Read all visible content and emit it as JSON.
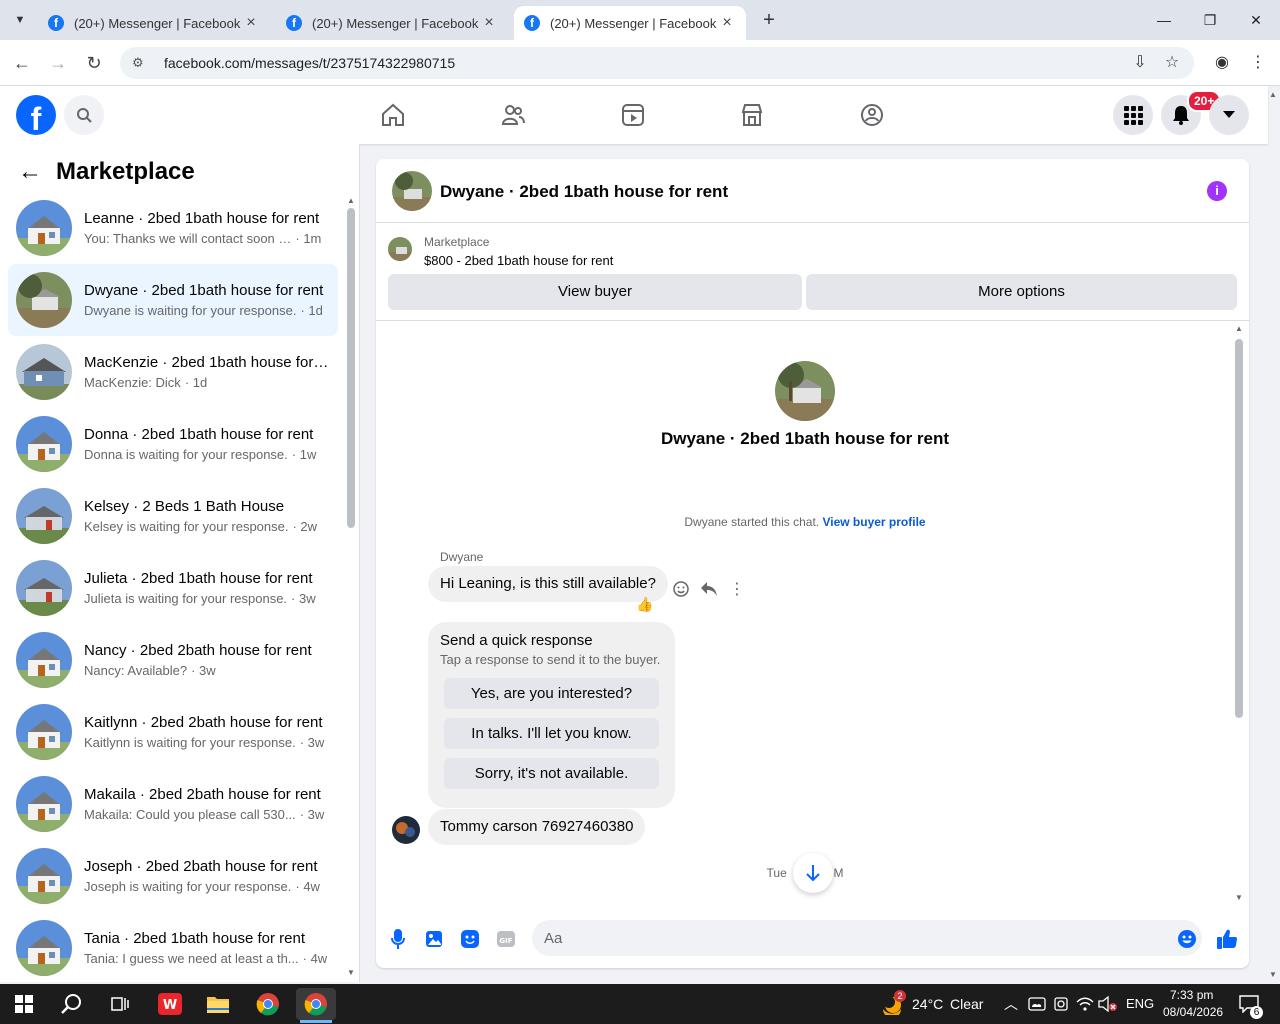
{
  "browser": {
    "tabs": [
      {
        "title": "(20+) Messenger | Facebook",
        "active": false
      },
      {
        "title": "(20+) Messenger | Facebook",
        "active": false
      },
      {
        "title": "(20+) Messenger | Facebook",
        "active": true
      }
    ],
    "url": "facebook.com/messages/t/2375174322980715",
    "new_tab": "+",
    "minimize": "—",
    "restore": "❐",
    "close": "✕"
  },
  "header": {
    "notification_count": "20+"
  },
  "sidebar": {
    "title": "Marketplace",
    "conversations": [
      {
        "title": "Leanne · 2bed 1bath house for rent",
        "snippet": "You: Thanks we will contact soon …",
        "time": "· 1m",
        "active": false,
        "thumb": "white-house"
      },
      {
        "title": "Dwyane · 2bed 1bath house for rent",
        "snippet": "Dwyane is waiting for your response.",
        "time": "· 1d",
        "active": true,
        "thumb": "tree-house"
      },
      {
        "title": "MacKenzie · 2bed 1bath house for rent",
        "snippet": "MacKenzie: Dick",
        "time": "· 1d",
        "active": false,
        "thumb": "blue-house"
      },
      {
        "title": "Donna · 2bed 1bath house for rent",
        "snippet": "Donna is waiting for your response.",
        "time": "· 1w",
        "active": false,
        "thumb": "white-house"
      },
      {
        "title": "Kelsey · 2 Beds 1 Bath House",
        "snippet": "Kelsey is waiting for your response.",
        "time": "· 2w",
        "active": false,
        "thumb": "grey-house"
      },
      {
        "title": "Julieta · 2bed 1bath house for rent",
        "snippet": "Julieta is waiting for your response.",
        "time": "· 3w",
        "active": false,
        "thumb": "grey-house"
      },
      {
        "title": "Nancy · 2bed 2bath house for rent",
        "snippet": "Nancy: Available?",
        "time": "· 3w",
        "active": false,
        "thumb": "white-house"
      },
      {
        "title": "Kaitlynn · 2bed 2bath house for rent",
        "snippet": "Kaitlynn is waiting for your response.",
        "time": "· 3w",
        "active": false,
        "thumb": "white-house"
      },
      {
        "title": "Makaila · 2bed 2bath house for rent",
        "snippet": "Makaila: Could you please call 530...",
        "time": "· 3w",
        "active": false,
        "thumb": "white-house"
      },
      {
        "title": "Joseph · 2bed 2bath house for rent",
        "snippet": "Joseph is waiting for your response.",
        "time": "· 4w",
        "active": false,
        "thumb": "white-house"
      },
      {
        "title": "Tania · 2bed 1bath house for rent",
        "snippet": "Tania: I guess we need at least a th...",
        "time": "· 4w",
        "active": false,
        "thumb": "white-house"
      }
    ]
  },
  "chat": {
    "title": "Dwyane · 2bed 1bath house for rent",
    "listing_source": "Marketplace",
    "listing_name": "$800 - 2bed 1bath house for rent",
    "view_buyer": "View buyer",
    "more_options": "More options",
    "intro_name": "Dwyane · 2bed 1bath house for rent",
    "started_text": "Dwyane started this chat.",
    "view_buyer_profile": "View buyer profile",
    "sender": "Dwyane",
    "first_message": "Hi Leaning, is this still available?",
    "reaction": "👍",
    "quick_title": "Send a quick response",
    "quick_subtitle": "Tap a response to send it to the buyer.",
    "quick_options": [
      "Yes, are you interested?",
      "In talks. I'll let you know.",
      "Sorry, it's not available."
    ],
    "second_message": "Tommy carson 76927460380",
    "timestamp_partial": "Tue",
    "timestamp_suffix": "M",
    "composer_placeholder": "Aa"
  },
  "taskbar": {
    "weather_temp": "24°C",
    "weather_desc": "Clear",
    "weather_badge": "2",
    "language": "ENG",
    "time": "7:33 pm",
    "date": "08/04/2026",
    "notification_count": "6"
  },
  "colors": {
    "facebook_blue": "#0866ff",
    "accent_purple": "#a033ff",
    "badge_red": "#e41e3f",
    "active_row": "#ebf5ff"
  }
}
